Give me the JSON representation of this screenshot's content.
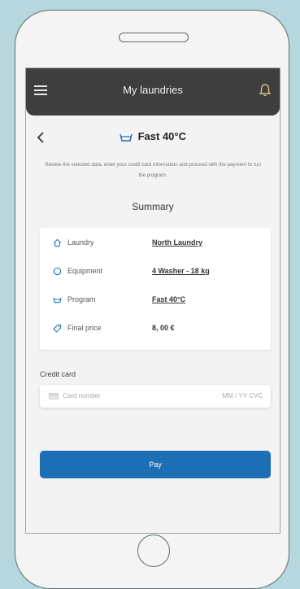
{
  "appbar": {
    "title": "My laundries"
  },
  "program": {
    "title": "Fast 40°C"
  },
  "intro": "Review the selected data, enter your credit card information and proceed with the payment to run the program.",
  "summary": {
    "title": "Summary",
    "rows": [
      {
        "label": "Laundry",
        "value": "North Laundry",
        "icon": "home-icon"
      },
      {
        "label": "Equipment",
        "value": "4 Washer - 18 kg",
        "icon": "washer-icon"
      },
      {
        "label": "Program",
        "value": "Fast 40°C",
        "icon": "wash-basin-icon"
      },
      {
        "label": "Final price",
        "value": "8, 00 €",
        "icon": "tag-icon"
      }
    ]
  },
  "payment": {
    "credit_card_label": "Credit card",
    "card_number_placeholder": "Card number",
    "expiry_placeholder": "MM / YY  CVC",
    "pay_label": "Pay"
  },
  "colors": {
    "appbar": "#3e3e3e",
    "accent": "#1d6fb5",
    "background": "#b5d7dd"
  }
}
